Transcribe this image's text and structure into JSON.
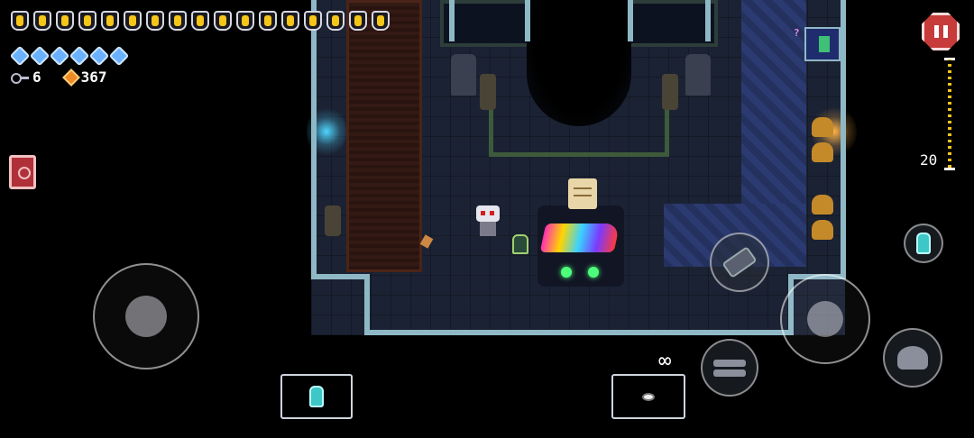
{
  "hud": {
    "heart_count": 17,
    "blank_count": 6,
    "keys_count": "6",
    "shells_count": "367",
    "ammo_display": "∞",
    "zoom_value": "20",
    "minimap_marker": "?"
  },
  "icons": {
    "hearts": "heart-container-icon",
    "blanks": "blank-icon",
    "keys": "key-icon",
    "currency": "shell-casing-icon",
    "book": "ammonomicon-book-icon",
    "pause": "pause-icon",
    "active_item": "blank-potion-icon",
    "reload": "reload-icon",
    "swap": "swap-weapon-icon",
    "dodge": "dodge-roll-icon",
    "gun": "gun-icon"
  },
  "colors": {
    "heart_fill": "#f5c518",
    "blank": "#6ab2ff",
    "shell": "#f08a24",
    "pause_bg": "#c83b3b",
    "wall": "#8fb8c6"
  }
}
